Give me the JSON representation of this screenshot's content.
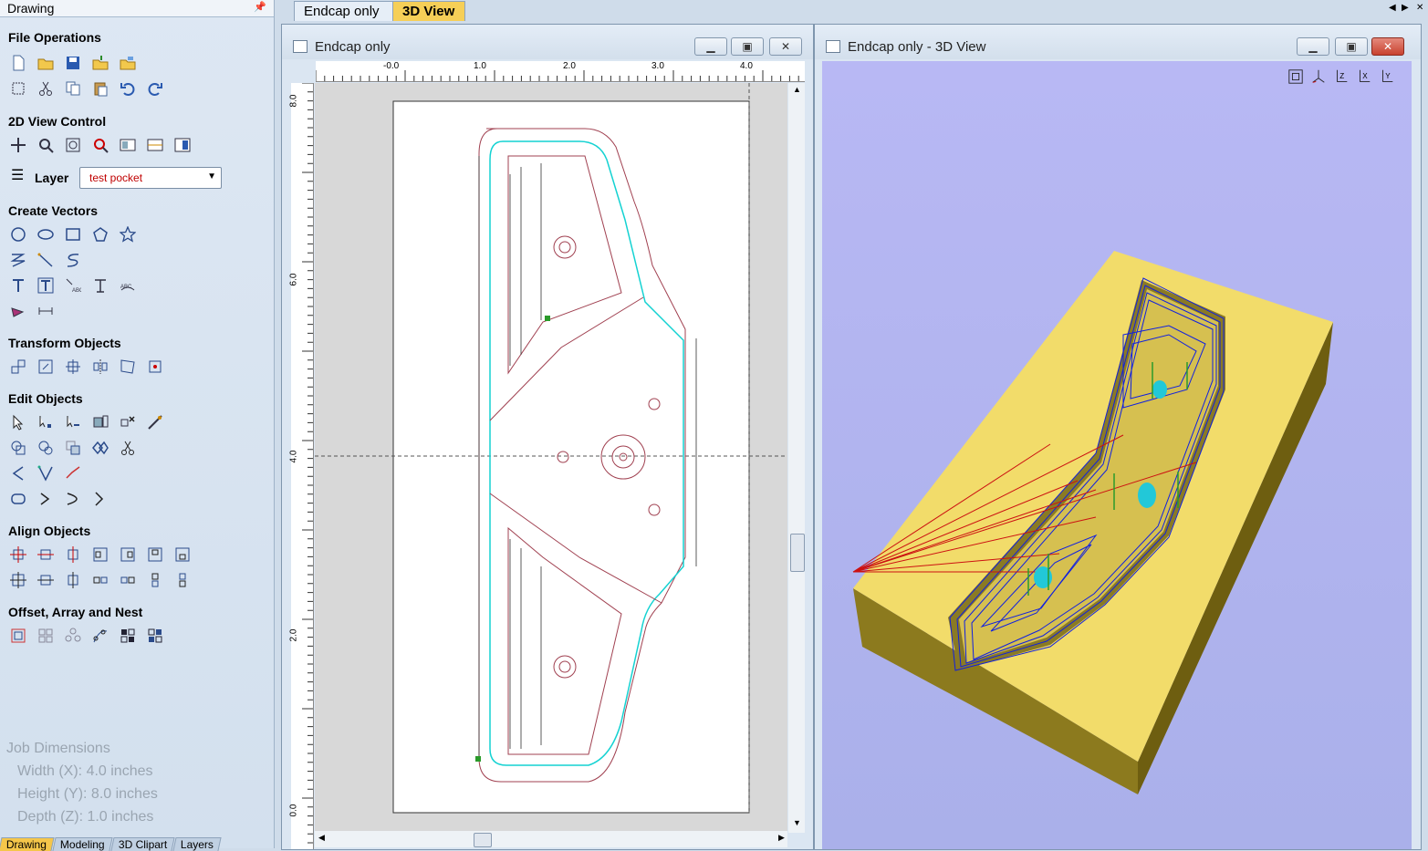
{
  "panel": {
    "title": "Drawing",
    "sections": {
      "file_operations": "File Operations",
      "view_control": "2D View Control",
      "create_vectors": "Create Vectors",
      "transform": "Transform Objects",
      "edit": "Edit Objects",
      "align": "Align Objects",
      "offset": "Offset, Array and Nest"
    },
    "layer_label": "Layer",
    "layer_value": "test pocket",
    "job_dimensions": {
      "heading": "Job Dimensions",
      "width": "Width  (X): 4.0 inches",
      "height": "Height (Y): 8.0 inches",
      "depth": "Depth  (Z): 1.0 inches"
    },
    "bottom_tabs": [
      "Drawing",
      "Modeling",
      "3D Clipart",
      "Layers"
    ]
  },
  "doc_tabs": [
    "Endcap only",
    "3D View"
  ],
  "window_2d": {
    "title": "Endcap only",
    "ruler_x": [
      "-0.0",
      "1.0",
      "2.0",
      "3.0",
      "4.0"
    ],
    "ruler_y": [
      "8.0",
      "6.0",
      "4.0",
      "2.0",
      "0.0"
    ]
  },
  "window_3d": {
    "title": "Endcap only - 3D View",
    "view_buttons": [
      "fit",
      "iso",
      "Z",
      "X",
      "Y"
    ]
  },
  "colors": {
    "accent_tab": "#f6cf57",
    "toolpath_red": "#cc1111",
    "toolpath_blue": "#1020e0",
    "vector_cyan": "#14d2d2",
    "material": "#f2dc6a"
  }
}
